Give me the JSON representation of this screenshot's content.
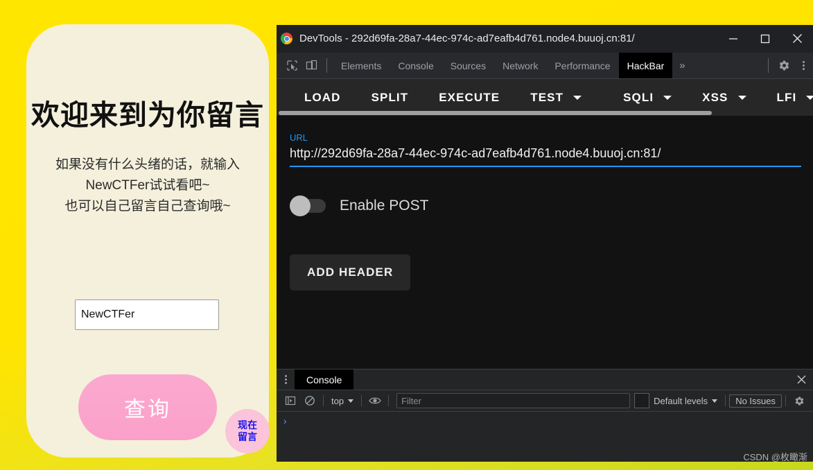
{
  "webpage": {
    "heading": "欢迎来到为你留言",
    "description_lines": [
      "如果没有什么头绪的话，就输入",
      "NewCTFer试试看吧~",
      "也可以自己留言自己查询哦~"
    ],
    "input_value": "NewCTFer",
    "input_placeholder": "",
    "query_button": "查询",
    "badge_line1": "现在",
    "badge_line2": "留言",
    "colors": {
      "background_top": "#ffe600",
      "background_bottom": "#c8d81c",
      "card": "#f4f0dc",
      "button": "#fba5cd",
      "badge_bg": "#fbc4da",
      "badge_text": "#1a13f0"
    }
  },
  "devtools": {
    "window_title": "DevTools - 292d69fa-28a7-44ec-974c-ad7eafb4d761.node4.buuoj.cn:81/",
    "window_controls": {
      "minimize": "minimize-icon",
      "maximize": "maximize-icon",
      "close": "close-icon"
    },
    "tabstrip": {
      "inspect_icon": "inspect-cursor-icon",
      "device_icon": "device-toolbar-icon",
      "tabs": [
        {
          "label": "Elements",
          "active": false
        },
        {
          "label": "Console",
          "active": false
        },
        {
          "label": "Sources",
          "active": false
        },
        {
          "label": "Network",
          "active": false
        },
        {
          "label": "Performance",
          "active": false
        },
        {
          "label": "HackBar",
          "active": true
        }
      ],
      "more_tabs": "»",
      "settings_icon": "gear-icon",
      "menu_icon": "kebab-menu-icon"
    },
    "hackbar": {
      "buttons": [
        {
          "label": "LOAD",
          "has_caret": false
        },
        {
          "label": "SPLIT",
          "has_caret": false
        },
        {
          "label": "EXECUTE",
          "has_caret": false
        },
        {
          "label": "TEST",
          "has_caret": true
        },
        {
          "label": "SQLI",
          "has_caret": true
        },
        {
          "label": "XSS",
          "has_caret": true
        },
        {
          "label": "LFI",
          "has_caret": true
        }
      ],
      "url_label": "URL",
      "url_value": "http://292d69fa-28a7-44ec-974c-ad7eafb4d761.node4.buuoj.cn:81/",
      "url_placeholder": "URL",
      "post_toggle_label": "Enable POST",
      "post_toggle_on": false,
      "add_header_label": "ADD HEADER",
      "accent_color": "#2196f3"
    },
    "drawer": {
      "menu_icon": "kebab-menu-icon",
      "tab_label": "Console",
      "close_icon": "close-icon",
      "console_filter": {
        "sidebar_icon": "console-sidebar-icon",
        "clear_icon": "clear-console-icon",
        "context": "top",
        "eye_icon": "eye-icon",
        "filter_placeholder": "Filter",
        "filter_value": "",
        "levels": "Default levels",
        "issues": "No Issues",
        "settings_icon": "gear-icon"
      },
      "prompt": "›"
    }
  },
  "watermark": "CSDN @枚瞰渐"
}
